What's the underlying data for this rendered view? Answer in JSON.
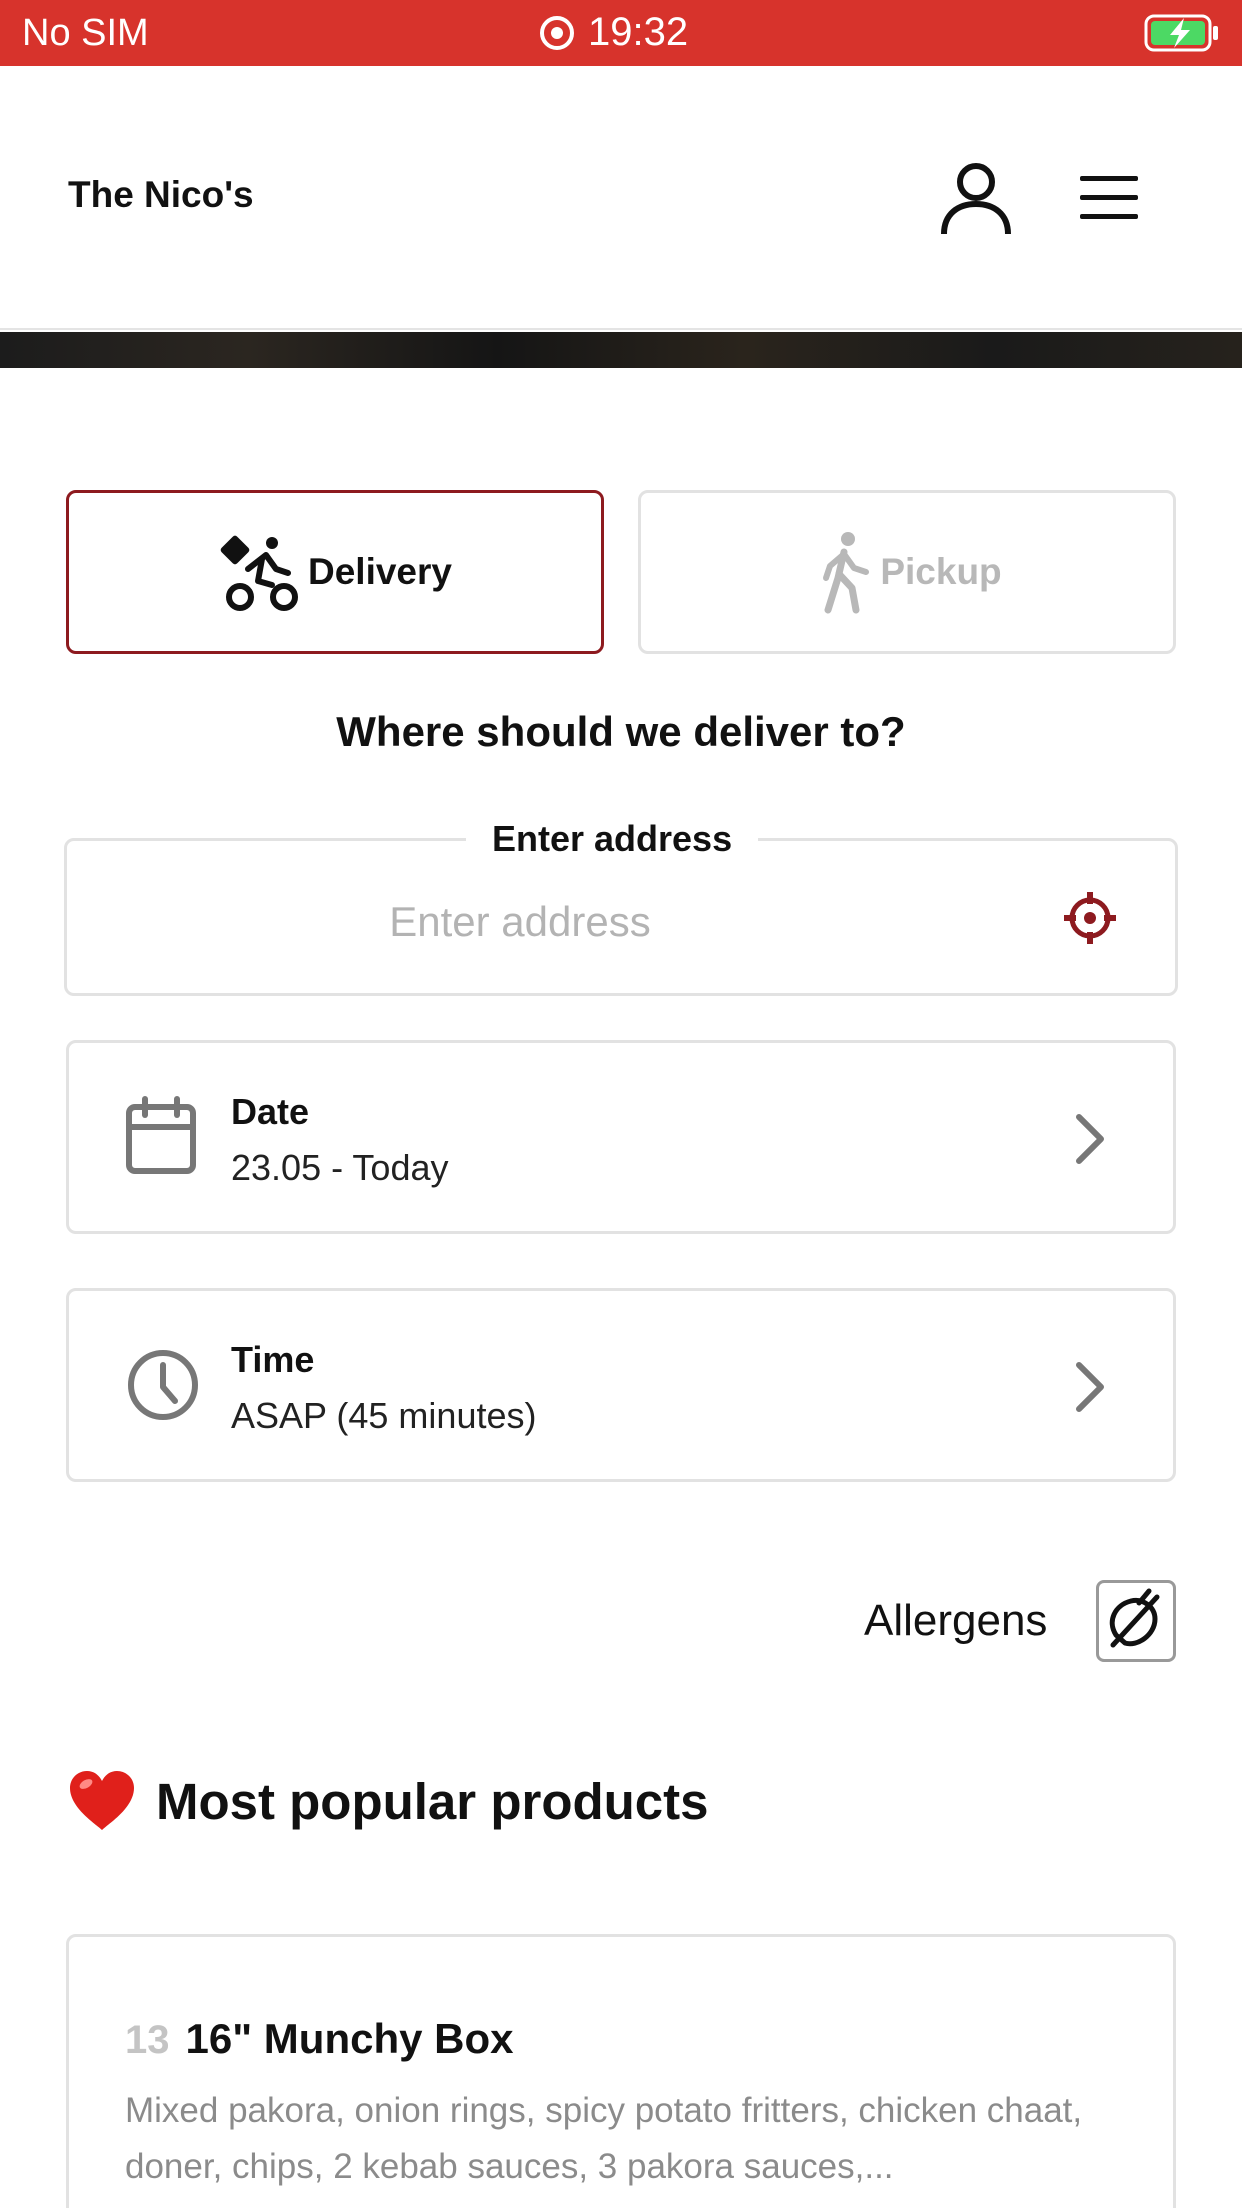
{
  "status_bar": {
    "carrier": "No SIM",
    "time": "19:32",
    "battery_state": "charging"
  },
  "header": {
    "brand": "The Nico's"
  },
  "order_mode": {
    "delivery_label": "Delivery",
    "pickup_label": "Pickup",
    "selected": "delivery"
  },
  "address": {
    "question": "Where should we deliver to?",
    "legend": "Enter address",
    "placeholder": "Enter address",
    "value": ""
  },
  "date": {
    "title": "Date",
    "value": "23.05 - Today"
  },
  "time": {
    "title": "Time",
    "value": "ASAP (45 minutes)"
  },
  "allergens": {
    "label": "Allergens"
  },
  "popular": {
    "heading": "Most popular products",
    "products": [
      {
        "number": "13",
        "name": "16\" Munchy Box",
        "description": "Mixed pakora, onion rings, spicy potato fritters, chicken chaat, doner, chips, 2 kebab sauces, 3 pakora sauces,..."
      }
    ]
  },
  "colors": {
    "status_bar": "#d7332c",
    "accent": "#8d1a1f",
    "border": "#e2e2e2",
    "muted_text": "#8b8b8b"
  },
  "icons": {
    "account": "user-icon",
    "menu": "hamburger-menu-icon",
    "delivery": "bicycle-courier-icon",
    "pickup": "walking-person-icon",
    "locate": "crosshair-icon",
    "date": "calendar-icon",
    "time": "clock-icon",
    "chevron": "chevron-right-icon",
    "allergens": "allergen-nut-icon",
    "heading": "heart-icon"
  }
}
